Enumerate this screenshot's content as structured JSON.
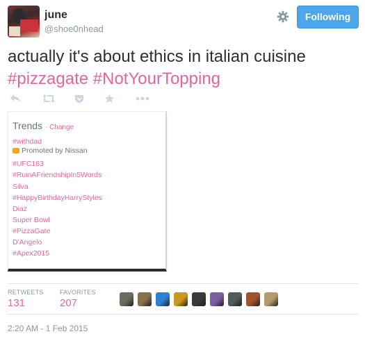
{
  "user": {
    "display_name": "june",
    "handle": "@shoe0nhead"
  },
  "header": {
    "follow_label": "Following",
    "gear_icon": "gear-icon"
  },
  "tweet": {
    "text": "actually it's about ethics in italian cuisine",
    "hashtags": [
      "#pizzagate",
      "#NotYourTopping"
    ]
  },
  "actions": [
    "reply-icon",
    "retweet-icon",
    "favorite-icon",
    "star-icon",
    "more-icon"
  ],
  "trends": {
    "title": "Trends",
    "change_label": "Change",
    "items": [
      "#withdad",
      "Promoted by Nissan",
      "#UFC183",
      "#RuinAFriendshipIn5Words",
      "Silva",
      "#HappyBirthdayHarryStyles",
      "Diaz",
      "Super Bowl",
      "#PizzaGate",
      "D'Angelo",
      "#Apex2015"
    ]
  },
  "stats": {
    "retweets_label": "RETWEETS",
    "retweets_value": "131",
    "favorites_label": "FAVORITES",
    "favorites_value": "207"
  },
  "likers_colors": [
    "#6b6b5e",
    "#8a6d4a",
    "#2f7fd6",
    "#c99a1d",
    "#3a3a3a",
    "#7a5fa0",
    "#4f5d5a",
    "#a0522d",
    "#b59a6d"
  ],
  "timestamp": "2:20 AM - 1 Feb 2015",
  "colors": {
    "hashtag": "#e0679e",
    "follow_button": "#4ca6ea",
    "muted": "#8899a6"
  }
}
